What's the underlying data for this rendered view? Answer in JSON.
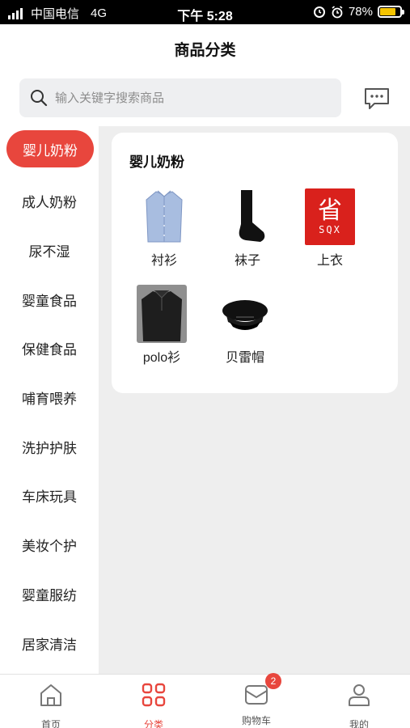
{
  "status_bar": {
    "carrier": "中国电信",
    "network": "4G",
    "time": "下午 5:28",
    "battery": "78%",
    "battery_level": 0.78
  },
  "header": {
    "title": "商品分类"
  },
  "search": {
    "placeholder": "输入关键字搜索商品",
    "value": ""
  },
  "sidebar": {
    "active_index": 0,
    "items": [
      {
        "label": "婴儿奶粉"
      },
      {
        "label": "成人奶粉"
      },
      {
        "label": "尿不湿"
      },
      {
        "label": "婴童食品"
      },
      {
        "label": "保健食品"
      },
      {
        "label": "哺育喂养"
      },
      {
        "label": "洗护护肤"
      },
      {
        "label": "车床玩具"
      },
      {
        "label": "美妆个护"
      },
      {
        "label": "婴童服纺"
      },
      {
        "label": "居家清洁"
      }
    ]
  },
  "panel": {
    "title": "婴儿奶粉",
    "items": [
      {
        "label": "衬衫",
        "icon": "shirt-image"
      },
      {
        "label": "袜子",
        "icon": "sock-image"
      },
      {
        "label": "上衣",
        "icon": "brand-logo-image",
        "logo_text_top": "省",
        "logo_text_bottom": "SQX"
      },
      {
        "label": "polo衫",
        "icon": "polo-image"
      },
      {
        "label": "贝雷帽",
        "icon": "beret-image"
      }
    ]
  },
  "tabbar": {
    "items": [
      {
        "label": "首页",
        "icon": "home-icon"
      },
      {
        "label": "分类",
        "icon": "category-icon"
      },
      {
        "label": "购物车",
        "icon": "cart-icon",
        "badge": "2"
      },
      {
        "label": "我的",
        "icon": "user-icon"
      }
    ],
    "active_index": 1
  },
  "colors": {
    "accent": "#e8463d",
    "content_bg": "#eeeeee",
    "search_bg": "#eeeff1"
  }
}
